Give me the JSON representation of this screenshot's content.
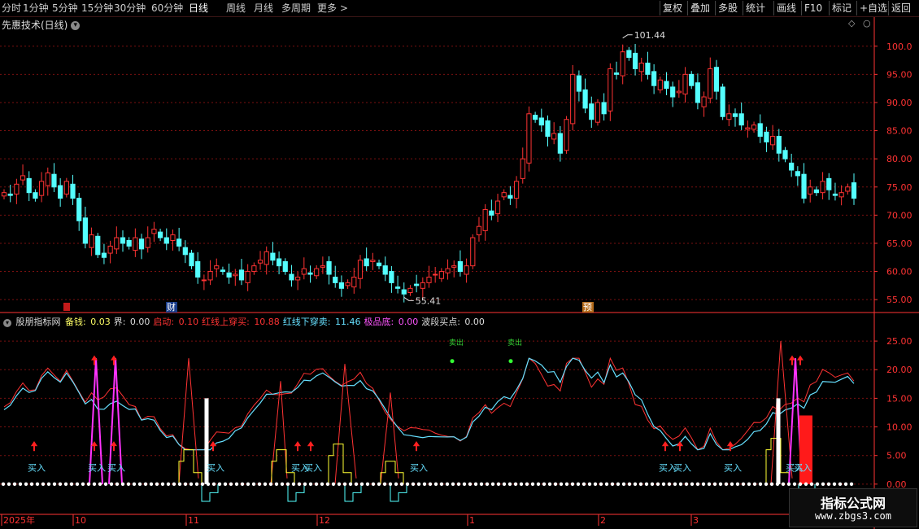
{
  "toolbar": {
    "left": [
      "分时",
      "1分钟",
      "5分钟",
      "15分钟",
      "30分钟",
      "60分钟",
      "日线",
      "周线",
      "月线",
      "多周期",
      "更多 >"
    ],
    "active": "日线",
    "right": [
      "复权",
      "叠加",
      "多股",
      "统计",
      "画线",
      "F10",
      "标记",
      "+自选",
      "返回"
    ]
  },
  "main_chart": {
    "title": "先惠技术(日线)",
    "high_label": "101.44",
    "low_label": "55.41",
    "marker_labels": [
      "财",
      "预"
    ],
    "y_ticks": [
      "100.0",
      "95.00",
      "90.00",
      "85.00",
      "80.00",
      "75.00",
      "70.00",
      "65.00",
      "60.00",
      "55.00"
    ]
  },
  "indicator": {
    "name": "股朋指标网",
    "legend": [
      {
        "label": "备钱:",
        "value": "0.03",
        "color": "#ffff66"
      },
      {
        "label": "界:",
        "value": "0.00",
        "color": "#dddddd"
      },
      {
        "label": "启动:",
        "value": "0.10",
        "color": "#ff3333"
      },
      {
        "label": "红线上穿买:",
        "value": "10.88",
        "color": "#ff3333"
      },
      {
        "label": "红线下穿卖:",
        "value": "11.46",
        "color": "#66e0ff"
      },
      {
        "label": "极品底:",
        "value": "0.00",
        "color": "#ff55ff"
      },
      {
        "label": "波段买点:",
        "value": "0.00",
        "color": "#dddddd"
      }
    ],
    "buy_label": "买入",
    "sell_label": "卖出",
    "y_ticks": [
      "25.00",
      "20.00",
      "15.00",
      "10.00",
      "5.00",
      "0.00"
    ]
  },
  "x_axis": {
    "labels": [
      "2025年",
      "10",
      "11",
      "12",
      "1",
      "2",
      "3"
    ]
  },
  "watermark": {
    "title": "指标公式网",
    "url": "www.zbgs3.com"
  },
  "colors": {
    "up": "#ff3333",
    "down": "#54ffff",
    "grid": "#7a1010",
    "axis": "#ff3333",
    "magenta": "#ff33ff",
    "yellow": "#ffff33"
  },
  "chart_data": {
    "type": "candlestick",
    "price_range": [
      55,
      101.44
    ],
    "closes": [
      74,
      73.5,
      75.5,
      77,
      74,
      73,
      76,
      77.5,
      75,
      73,
      76,
      73,
      69,
      65,
      66.5,
      63,
      62.5,
      64.5,
      66,
      65,
      64.5,
      66,
      64,
      66,
      67.5,
      66,
      65,
      66.5,
      64.5,
      63,
      61,
      59,
      58.5,
      60,
      61,
      60,
      59,
      59.5,
      58.5,
      60,
      61,
      62,
      63.5,
      62,
      61,
      60,
      58.5,
      59,
      60.5,
      59.5,
      60.5,
      61,
      59.5,
      58,
      57,
      58,
      59,
      62,
      61,
      62,
      61,
      59.5,
      58,
      57,
      56,
      57,
      57.5,
      58,
      59,
      59.5,
      60,
      60.5,
      61,
      60,
      61,
      66,
      68,
      71,
      70,
      72.5,
      74,
      73,
      76,
      80,
      88,
      87,
      86,
      84,
      84.5,
      81,
      87,
      95,
      92,
      89,
      87,
      90,
      88,
      96,
      95,
      99,
      98,
      96,
      97,
      95,
      93,
      94,
      92.5,
      91,
      92,
      95,
      93,
      90,
      91,
      96,
      92,
      87.5,
      88,
      87.5,
      86,
      85.5,
      86,
      84,
      83,
      84,
      81,
      80,
      78,
      77,
      73,
      75,
      74,
      76,
      74.5,
      73.5,
      74,
      75,
      73
    ],
    "indicator_series": [
      {
        "name": "备钱",
        "color": "#ffff66"
      },
      {
        "name": "启动",
        "color": "#ff3333"
      },
      {
        "name": "红线上穿买",
        "color": "#ff3333"
      },
      {
        "name": "红线下穿卖",
        "color": "#66e0ff"
      },
      {
        "name": "极品底",
        "color": "#ff55ff"
      }
    ]
  }
}
